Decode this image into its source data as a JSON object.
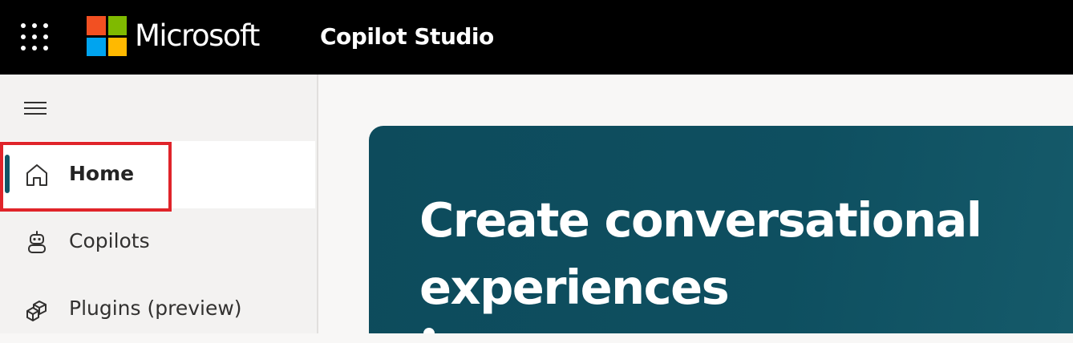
{
  "topbar": {
    "brand": "Microsoft",
    "app_title": "Copilot Studio",
    "logo_colors": [
      "#f25022",
      "#7fba00",
      "#00a4ef",
      "#ffb900"
    ]
  },
  "sidebar": {
    "items": [
      {
        "label": "Home",
        "icon": "home-icon",
        "active": true
      },
      {
        "label": "Copilots",
        "icon": "bot-icon",
        "active": false
      },
      {
        "label": "Plugins (preview)",
        "icon": "cube-icon",
        "active": false
      }
    ]
  },
  "hero": {
    "title": "Create conversational experiences"
  },
  "colors": {
    "accent": "#0f5566",
    "highlight": "#e0242a",
    "hero_bg": "#0d4b5c"
  }
}
